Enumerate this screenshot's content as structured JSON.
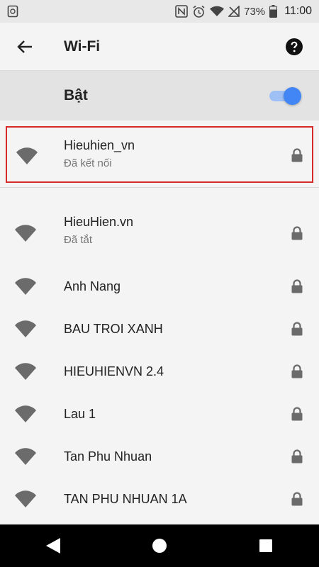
{
  "status_bar": {
    "battery_percent": "73%",
    "time": "11:00",
    "icons": [
      "sync-icon",
      "nfc-icon",
      "alarm-icon",
      "wifi-status-icon",
      "no-signal-icon",
      "battery-icon"
    ]
  },
  "app_bar": {
    "title": "Wi-Fi",
    "back_icon": "arrow-left-icon",
    "help_icon": "help-circle-icon"
  },
  "toggle": {
    "label": "Bật",
    "on": true,
    "accent": "#4285f4"
  },
  "connected_network": {
    "name": "Hieuhien_vn",
    "status": "Đã kết nối",
    "secured": true,
    "highlight_color": "#d62a2a"
  },
  "networks": [
    {
      "name": "HieuHien.vn",
      "status": "Đã tắt",
      "secured": true
    },
    {
      "name": "Anh Nang",
      "status": "",
      "secured": true
    },
    {
      "name": "BAU TROI XANH",
      "status": "",
      "secured": true
    },
    {
      "name": "HIEUHIENVN 2.4",
      "status": "",
      "secured": true
    },
    {
      "name": "Lau 1",
      "status": "",
      "secured": true
    },
    {
      "name": "Tan Phu Nhuan",
      "status": "",
      "secured": true
    },
    {
      "name": "TAN PHU NHUAN 1A",
      "status": "",
      "secured": true
    }
  ],
  "nav_bar": {
    "buttons": [
      "back-triangle-icon",
      "home-circle-icon",
      "recents-square-icon"
    ]
  }
}
